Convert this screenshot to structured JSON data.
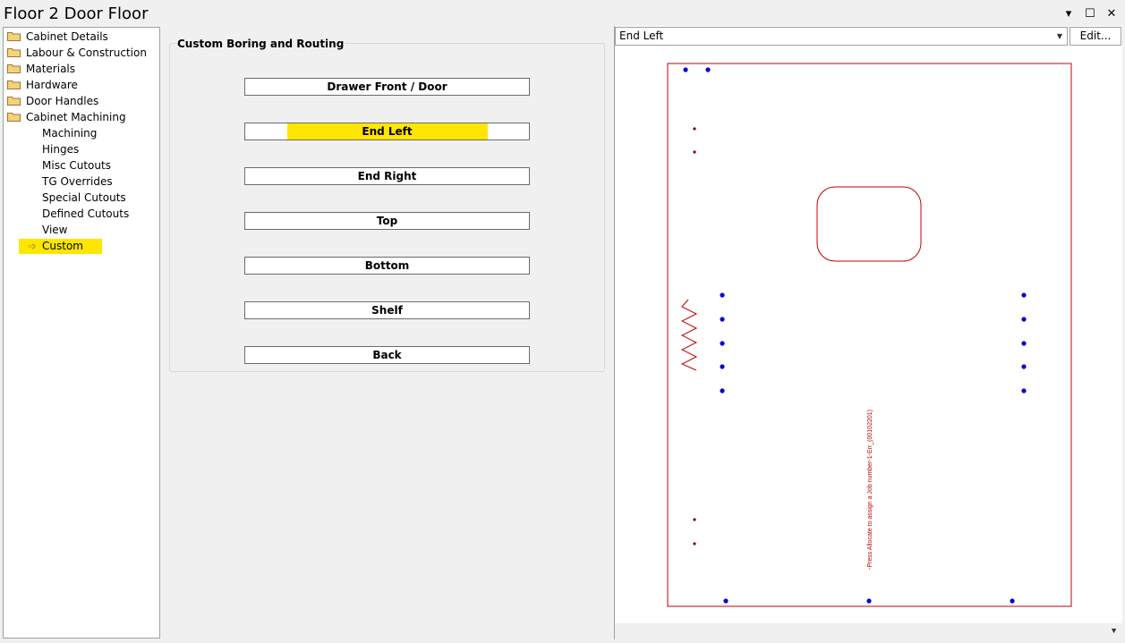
{
  "window": {
    "title": "Floor 2 Door Floor",
    "controls": [
      "▾",
      "☐",
      "✕"
    ]
  },
  "tree": {
    "items": [
      {
        "label": "Cabinet Details",
        "icon": "folder-icon",
        "level": 0
      },
      {
        "label": "Labour & Construction",
        "icon": "folder-icon",
        "level": 0
      },
      {
        "label": "Materials",
        "icon": "folder-icon",
        "level": 0
      },
      {
        "label": "Hardware",
        "icon": "folder-icon",
        "level": 0
      },
      {
        "label": "Door Handles",
        "icon": "folder-icon",
        "level": 0
      },
      {
        "label": "Cabinet Machining",
        "icon": "folder-icon",
        "level": 0
      },
      {
        "label": "Machining",
        "level": 1
      },
      {
        "label": "Hinges",
        "level": 1
      },
      {
        "label": "Misc Cutouts",
        "level": 1
      },
      {
        "label": "TG Overrides",
        "level": 1
      },
      {
        "label": "Special Cutouts",
        "level": 1
      },
      {
        "label": "Defined Cutouts",
        "level": 1
      },
      {
        "label": "View",
        "level": 1
      },
      {
        "label": "Custom",
        "level": 1,
        "selected": true,
        "icon": "arrow-icon"
      }
    ]
  },
  "boring": {
    "group_title": "Custom Boring and Routing",
    "buttons": [
      {
        "label": "Drawer Front / Door"
      },
      {
        "label": "End Left",
        "active": true
      },
      {
        "label": "End Right"
      },
      {
        "label": "Top"
      },
      {
        "label": "Bottom"
      },
      {
        "label": "Shelf"
      },
      {
        "label": "Back"
      }
    ],
    "highlight_color": "#ffe600"
  },
  "preview": {
    "selected_part": "End Left",
    "edit_label": "Edit...",
    "note_text": "-Press Allocate to assign a Job number-1-Err_(00102201)",
    "outline_color": "#c00000",
    "hole_color": "#0000e0",
    "small_hole_color": "#800000"
  }
}
